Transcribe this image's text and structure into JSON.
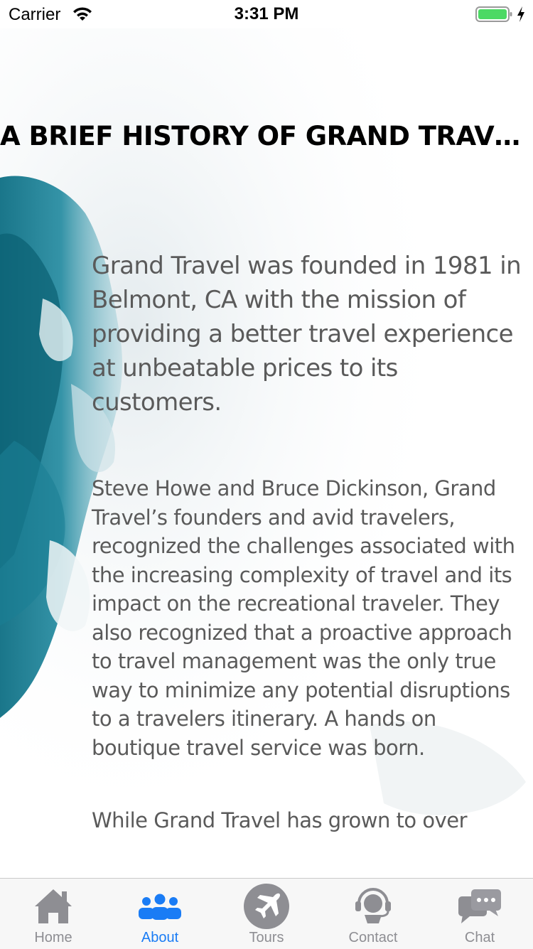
{
  "status_bar": {
    "carrier": "Carrier",
    "time": "3:31 PM"
  },
  "page": {
    "title": "A BRIEF HISTORY OF GRAND TRAVEL",
    "lead": "Grand Travel was founded in 1981 in Belmont, CA with the mission of providing a better travel experience at unbeatable prices to its customers.",
    "paragraphs": [
      "Steve Howe and Bruce Dickinson, Grand Travel’s founders and avid travelers, recognized the challenges associated with the increasing complexity of travel and its impact on the recreational traveler. They also recognized that a proactive approach to travel management was the only true way to minimize any potential disruptions to a travelers itinerary. A hands on boutique travel service was born.",
      "While Grand Travel has grown to over"
    ]
  },
  "tabbar": {
    "active_color": "#1a7cf5",
    "inactive_color": "#8e8e93",
    "tabs": [
      {
        "label": "Home",
        "icon": "home-icon"
      },
      {
        "label": "About",
        "icon": "people-icon"
      },
      {
        "label": "Tours",
        "icon": "airplane-icon"
      },
      {
        "label": "Contact",
        "icon": "headset-icon"
      },
      {
        "label": "Chat",
        "icon": "chat-bubbles-icon"
      }
    ],
    "selected": "About"
  }
}
